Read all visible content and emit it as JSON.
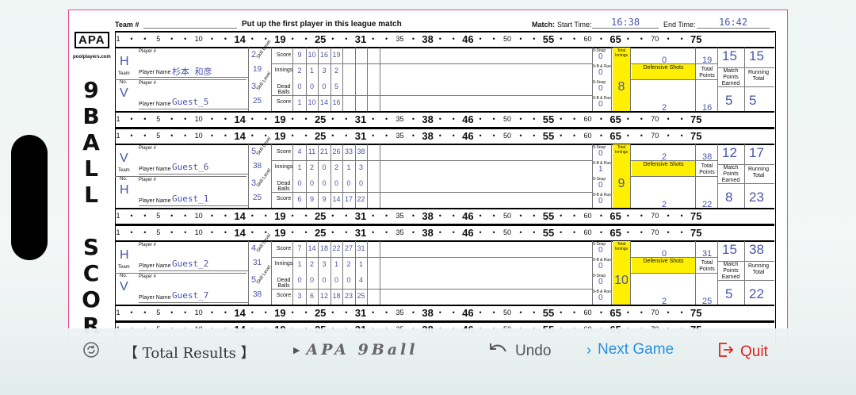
{
  "scoresheet": {
    "team_label": "Team #",
    "header_note": "Put up the first player in this league match",
    "match_label": "Match:",
    "start_label": "Start Time:",
    "start_time": "16:38",
    "end_label": "End Time:",
    "end_time": "16:42",
    "logo_text": "APA",
    "logo_url": "poolplayers.com",
    "side_title": [
      "9",
      "B",
      "A",
      "L",
      "L",
      "",
      "S",
      "C",
      "O",
      "R",
      "E"
    ],
    "ruler": [
      "1",
      "•",
      "•",
      "5",
      "•",
      "•",
      "10",
      "•",
      "•",
      "14",
      "•",
      "•",
      "19",
      "•",
      "•",
      "25",
      "•",
      "•",
      "31",
      "•",
      "•",
      "35",
      "•",
      "38",
      "•",
      "•",
      "46",
      "•",
      "•",
      "50",
      "•",
      "•",
      "55",
      "•",
      "•",
      "60",
      "•",
      "65",
      "•",
      "•",
      "70",
      "•",
      "•",
      "75"
    ],
    "labels": {
      "player_num": "Player #",
      "player_name": "Player Name",
      "team": "Team",
      "no": "No.",
      "skill_level": "Skill Level",
      "balls_needed": "Ball Count",
      "score": "Score",
      "innings": "Innings",
      "dead_balls": "Dead Balls",
      "nine_snap": "9-Snap",
      "nine_run": "9-B & Run",
      "total_innings": "Total Innings",
      "defensive_shots": "Defensive Shots",
      "total_points": "Total Points",
      "match_points_earned": "Match Points Earned",
      "running_total": "Running Total"
    },
    "games": [
      {
        "top": {
          "hv": "H",
          "name": "杉本 和彦",
          "skill": "2",
          "need": "19",
          "scores": [
            "9",
            "10",
            "16",
            "19"
          ],
          "innings": [
            "2",
            "1",
            "3",
            "2"
          ],
          "snap": "0",
          "run": "0",
          "def": "0",
          "points": "19",
          "match_pts": "15",
          "running": "15"
        },
        "bot": {
          "hv": "V",
          "name": "Guest_5",
          "skill": "3",
          "need": "25",
          "scores": [
            "1",
            "10",
            "14",
            "16"
          ],
          "dead": [
            "0",
            "0",
            "0",
            "5"
          ],
          "snap": "0",
          "run": "0",
          "def": "2",
          "points": "16",
          "match_pts": "5",
          "running": "5"
        },
        "total_innings": "8"
      },
      {
        "top": {
          "hv": "V",
          "name": "Guest_6",
          "skill": "5",
          "need": "38",
          "scores": [
            "4",
            "11",
            "21",
            "26",
            "33",
            "38"
          ],
          "innings": [
            "1",
            "2",
            "0",
            "2",
            "1",
            "3"
          ],
          "snap": "0",
          "run": "1",
          "def": "2",
          "points": "38",
          "match_pts": "12",
          "running": "17"
        },
        "bot": {
          "hv": "H",
          "name": "Guest_1",
          "skill": "3",
          "need": "25",
          "scores": [
            "6",
            "9",
            "9",
            "14",
            "17",
            "22"
          ],
          "dead": [
            "0",
            "0",
            "0",
            "0",
            "0",
            "0"
          ],
          "snap": "0",
          "run": "0",
          "def": "2",
          "points": "22",
          "match_pts": "8",
          "running": "23"
        },
        "total_innings": "9"
      },
      {
        "top": {
          "hv": "H",
          "name": "Guest_2",
          "skill": "4",
          "need": "31",
          "scores": [
            "7",
            "14",
            "18",
            "22",
            "27",
            "31"
          ],
          "innings": [
            "1",
            "2",
            "3",
            "1",
            "2",
            "1"
          ],
          "snap": "0",
          "run": "0",
          "def": "0",
          "points": "31",
          "match_pts": "15",
          "running": "38"
        },
        "bot": {
          "hv": "V",
          "name": "Guest_7",
          "skill": "5",
          "need": "38",
          "scores": [
            "3",
            "6",
            "12",
            "18",
            "23",
            "25"
          ],
          "dead": [
            "0",
            "0",
            "0",
            "0",
            "0",
            "4"
          ],
          "snap": "0",
          "run": "0",
          "def": "2",
          "points": "25",
          "match_pts": "5",
          "running": "22"
        },
        "total_innings": "10"
      }
    ]
  },
  "bottom_bar": {
    "total_results": "【 Total Results 】",
    "game_title": "APA 9Ball",
    "undo": "Undo",
    "next_game": "Next Game",
    "quit": "Quit"
  },
  "colors": {
    "accent_blue": "#2a8fe0",
    "quit_red": "#e02020",
    "handwriting": "#4a56a8",
    "highlight_yellow": "#ffef00"
  }
}
